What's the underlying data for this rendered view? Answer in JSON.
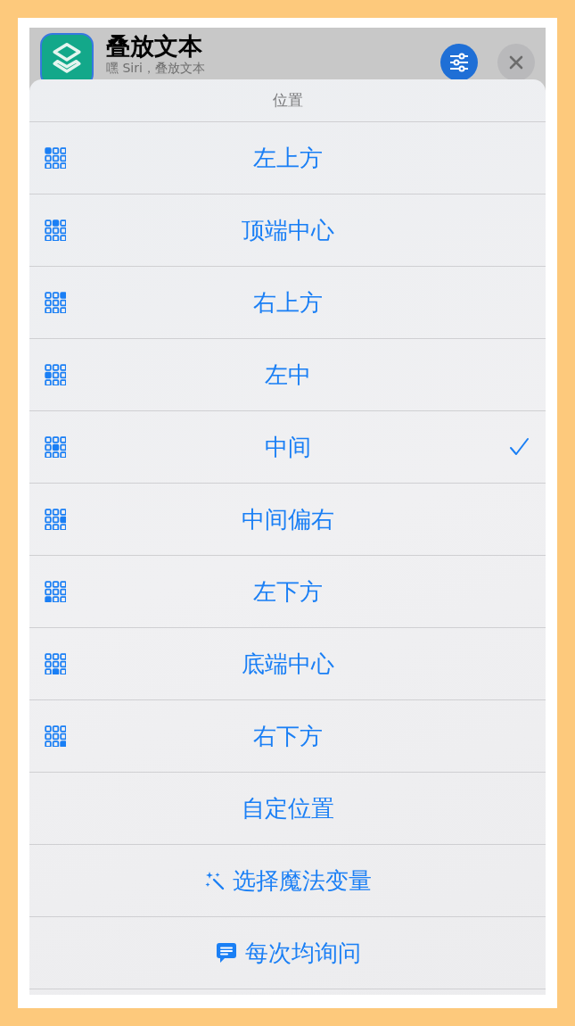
{
  "header": {
    "title": "叠放文本",
    "subtitle": "嘿 Siri，叠放文本"
  },
  "sheet": {
    "title": "位置",
    "options": [
      {
        "kind": "position",
        "cells": [
          true,
          false,
          false,
          false,
          false,
          false,
          false,
          false,
          false
        ],
        "label": "左上方",
        "selected": false
      },
      {
        "kind": "position",
        "cells": [
          false,
          true,
          false,
          false,
          false,
          false,
          false,
          false,
          false
        ],
        "label": "顶端中心",
        "selected": false
      },
      {
        "kind": "position",
        "cells": [
          false,
          false,
          true,
          false,
          false,
          false,
          false,
          false,
          false
        ],
        "label": "右上方",
        "selected": false
      },
      {
        "kind": "position",
        "cells": [
          false,
          false,
          false,
          true,
          false,
          false,
          false,
          false,
          false
        ],
        "label": "左中",
        "selected": false
      },
      {
        "kind": "position",
        "cells": [
          false,
          false,
          false,
          false,
          true,
          false,
          false,
          false,
          false
        ],
        "label": "中间",
        "selected": true
      },
      {
        "kind": "position",
        "cells": [
          false,
          false,
          false,
          false,
          false,
          true,
          false,
          false,
          false
        ],
        "label": "中间偏右",
        "selected": false
      },
      {
        "kind": "position",
        "cells": [
          false,
          false,
          false,
          false,
          false,
          false,
          true,
          false,
          false
        ],
        "label": "左下方",
        "selected": false
      },
      {
        "kind": "position",
        "cells": [
          false,
          false,
          false,
          false,
          false,
          false,
          false,
          true,
          false
        ],
        "label": "底端中心",
        "selected": false
      },
      {
        "kind": "position",
        "cells": [
          false,
          false,
          false,
          false,
          false,
          false,
          false,
          false,
          true
        ],
        "label": "右下方",
        "selected": false
      },
      {
        "kind": "plain",
        "label": "自定位置",
        "selected": false
      },
      {
        "kind": "magic",
        "label": "选择魔法变量",
        "selected": false
      },
      {
        "kind": "ask",
        "label": "每次均询问",
        "selected": false
      }
    ]
  }
}
